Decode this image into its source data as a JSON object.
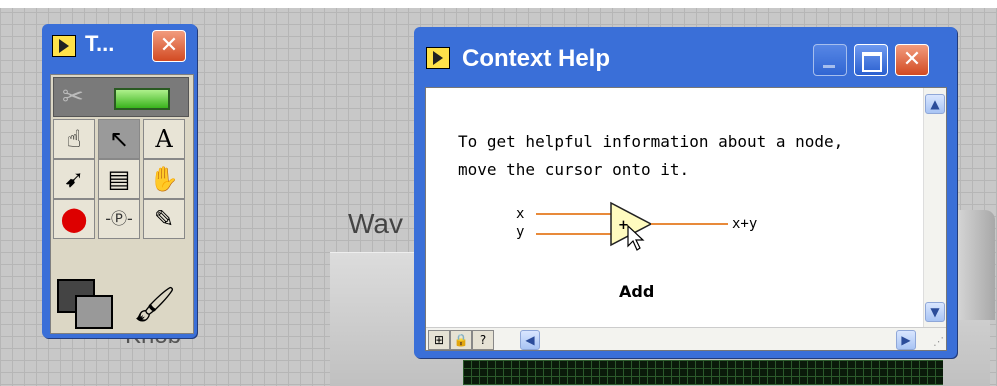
{
  "background": {
    "labels": {
      "wave": "Wav",
      "knob": "Knob"
    }
  },
  "tools_palette": {
    "title": "T...",
    "icons": [
      "operate-hand-icon",
      "position-arrow-icon",
      "text-edit-icon",
      "wiring-spool-icon",
      "shortcut-menu-icon",
      "scroll-hand-icon",
      "breakpoint-icon",
      "probe-icon",
      "color-dropper-icon",
      "color-swatch-icon",
      "paintbrush-icon"
    ]
  },
  "context_help": {
    "title": "Context Help",
    "text_line1": "To get helpful information about a node,",
    "text_line2": "move the cursor onto it.",
    "diagram": {
      "input_x": "x",
      "input_y": "y",
      "output": "x+y",
      "symbol": "+"
    },
    "caption": "Add",
    "colors": {
      "wire": "#e88a3a",
      "node_fill": "#fffbbf"
    }
  }
}
